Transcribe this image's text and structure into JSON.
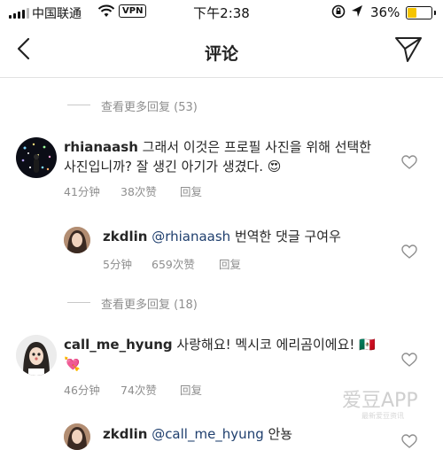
{
  "status_bar": {
    "carrier": "中国联通",
    "vpn": "VPN",
    "time": "下午2:38",
    "battery_pct": "36%",
    "battery_level": 0.36,
    "battery_color": "#f5c400"
  },
  "nav": {
    "title": "评论",
    "back_icon": "chevron-left-icon",
    "send_icon": "paper-plane-icon"
  },
  "threads": [
    {
      "more_replies": "查看更多回复 (53)",
      "comment": {
        "username": "rhianaash",
        "text_line1": "그래서 이것은 프로필 사진을 위해 선택한",
        "text_line2": "사진입니까? 잘 생긴 아기가 생겼다. ",
        "emoji": "😍",
        "time": "41分钟",
        "likes": "38次赞",
        "reply": "回复"
      },
      "reply": {
        "username": "zkdlin",
        "mention": "@rhianaash",
        "text": " 번역한 댓글 구여우",
        "time": "5分钟",
        "likes": "659次赞",
        "reply": "回复"
      }
    },
    {
      "more_replies": "查看更多回复 (18)",
      "comment": {
        "username": "call_me_hyung",
        "text_line1": " 사랑해요! 멕시코 에리곰이에요! ",
        "flag": "🇲🇽",
        "text_line2": "💘",
        "time": "46分钟",
        "likes": "74次赞",
        "reply": "回复"
      },
      "reply": {
        "username": "zkdlin",
        "mention": "@call_me_hyung",
        "text": " 안뇽"
      }
    }
  ],
  "watermark": {
    "text": "爱豆APP",
    "sub": "最新爱豆资讯"
  }
}
